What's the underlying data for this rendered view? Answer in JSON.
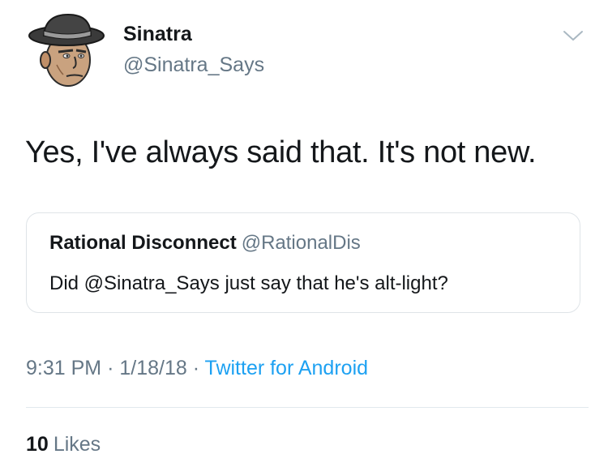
{
  "author": {
    "display_name": "Sinatra",
    "handle": "@Sinatra_Says",
    "avatar_icon": "cartoon-fedora-man-avatar"
  },
  "tweet": {
    "text": "Yes, I've always said that. It's not new."
  },
  "quoted_tweet": {
    "author_name": "Rational Disconnect",
    "author_handle": "@RationalDis",
    "text": "Did @Sinatra_Says just say that he's alt-light?"
  },
  "meta": {
    "time": "9:31 PM",
    "separator": "·",
    "date": "1/18/18",
    "source": "Twitter for Android"
  },
  "engagement": {
    "likes_count": "10",
    "likes_label": "Likes"
  },
  "colors": {
    "secondary_text": "#657786",
    "link": "#1da1f2",
    "primary_text": "#14171a",
    "border": "#dfe4e8"
  },
  "icons": {
    "menu": "chevron-down-icon"
  }
}
